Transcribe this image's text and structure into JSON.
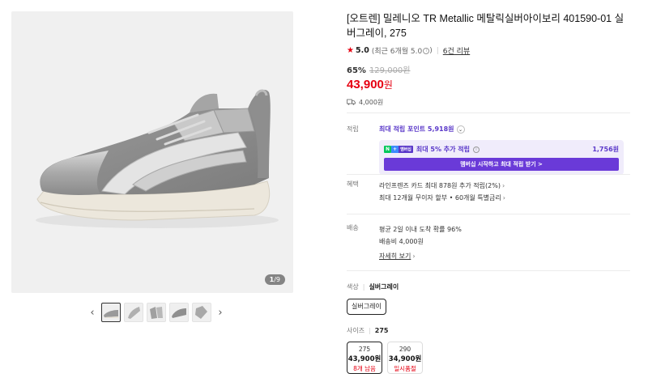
{
  "gallery": {
    "counter_current": "1",
    "counter_total": "/9",
    "prev_icon": "chevron-left-icon",
    "next_icon": "chevron-right-icon"
  },
  "product": {
    "title": "[오트렌] 밀레니오 TR Metallic 메탈릭실버아이보리 401590-01 실버그레이, 275",
    "rating": "5.0",
    "rating_note": "(최근 6개월 5.0",
    "rating_note_end": ")",
    "review_link": "6건 리뷰",
    "discount": "65%",
    "original_price": "129,000원",
    "price": "43,900",
    "price_unit": "원",
    "shipping_fee": "4,000원"
  },
  "points": {
    "label": "적립",
    "max_points": "최대 적립 포인트 5,918원",
    "membership_extra": "최대 5% 추가 적립",
    "membership_amount": "1,756원",
    "membership_button": "멤버십 시작하고 최대 적립 받기 >",
    "badge_n": "N",
    "badge_plus": "+",
    "badge_text": "멤버십"
  },
  "benefits": {
    "label": "혜택",
    "line1": "라인프렌즈 카드 최대 878원 추가 적립(2%)",
    "line2": "최대 12개월 무이자 할부 • 60개월 특별금리"
  },
  "delivery": {
    "label": "배송",
    "line1": "평균 2일 이내 도착 확률 96%",
    "line2": "배송비 4,000원",
    "detail_link": "자세히 보기"
  },
  "options": {
    "color_label": "색상",
    "color_selected": "실버그레이",
    "color_chip": "실버그레이",
    "size_label": "사이즈",
    "size_selected": "275",
    "sizes": [
      {
        "size": "275",
        "price": "43,900원",
        "stock": "8개 남음"
      },
      {
        "size": "290",
        "price": "34,900원",
        "stock": "일시품절"
      }
    ]
  },
  "colors": {
    "accent_red": "#e60012",
    "member_purple": "#5a38c9"
  }
}
